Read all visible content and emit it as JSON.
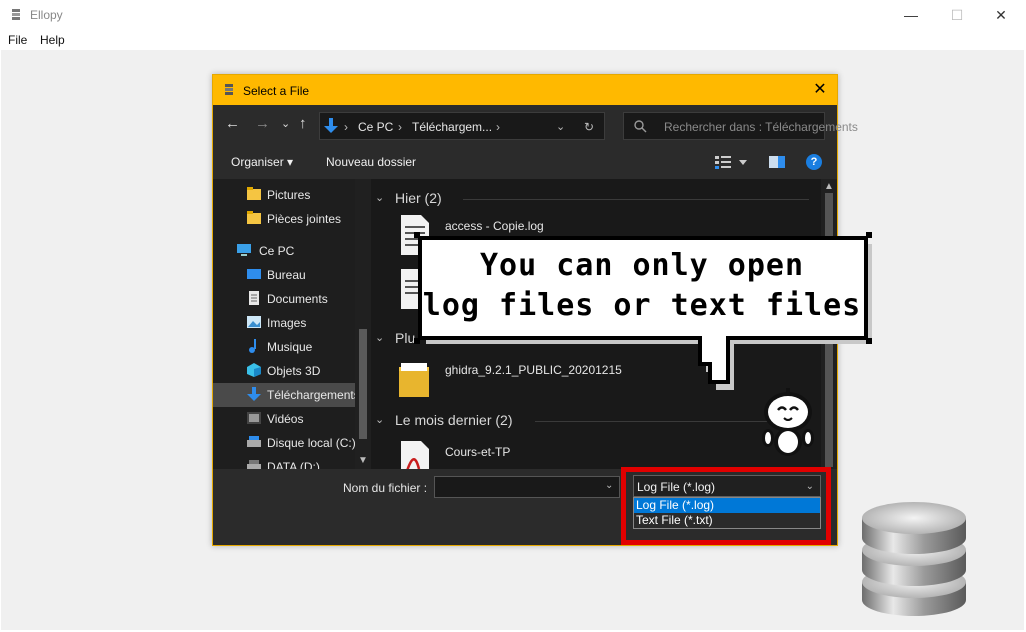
{
  "window": {
    "title": "Ellopy",
    "controls": {
      "minimize": "—",
      "maximize": "☐",
      "close": "✕"
    }
  },
  "menubar": {
    "items": [
      "File",
      "Help"
    ]
  },
  "dialog": {
    "title": "Select a File",
    "close_glyph": "✕",
    "nav": {
      "back": "←",
      "forward": "→",
      "recent": "⌄",
      "up": "↑",
      "refresh": "↻",
      "breadcrumbs": [
        "Ce PC",
        "Téléchargem..."
      ]
    },
    "search_placeholder": "Rechercher dans : Téléchargements",
    "toolbar": {
      "organize": "Organiser",
      "new_folder": "Nouveau dossier",
      "help": "?"
    },
    "sidebar": [
      {
        "label": "Pictures",
        "icon": "folder-icon"
      },
      {
        "label": "Pièces jointes",
        "icon": "folder-icon"
      },
      {
        "label": "Ce PC",
        "icon": "computer-icon"
      },
      {
        "label": "Bureau",
        "icon": "desktop-icon"
      },
      {
        "label": "Documents",
        "icon": "documents-icon"
      },
      {
        "label": "Images",
        "icon": "images-icon"
      },
      {
        "label": "Musique",
        "icon": "music-icon"
      },
      {
        "label": "Objets 3D",
        "icon": "objects3d-icon"
      },
      {
        "label": "Téléchargements",
        "icon": "downloads-icon",
        "selected": true
      },
      {
        "label": "Vidéos",
        "icon": "videos-icon"
      },
      {
        "label": "Disque local (C:)",
        "icon": "drive-icon"
      },
      {
        "label": "DATA (D:)",
        "icon": "drive-icon"
      }
    ],
    "groups": [
      {
        "header": "Hier (2)",
        "files": [
          {
            "name": "access - Copie.log",
            "icon": "document-icon"
          },
          {
            "name": "",
            "icon": "document-icon"
          }
        ]
      },
      {
        "header": "Plu",
        "files": [
          {
            "name": "ghidra_9.2.1_PUBLIC_20201215",
            "icon": "folder-icon"
          }
        ]
      },
      {
        "header": "Le mois dernier (2)",
        "files": [
          {
            "name": "Cours-et-TP",
            "icon": "pdf-icon"
          }
        ]
      }
    ],
    "filename_label": "Nom du fichier :",
    "filename_value": "",
    "filetype": {
      "selected": "Log File (*.log)",
      "options": [
        "Log File (*.log)",
        "Text File (*.txt)"
      ]
    }
  },
  "annotation": {
    "bubble_line1": "You can only open",
    "bubble_line2": "log files or text files"
  },
  "colors": {
    "dialog_titlebar": "#ffb900",
    "highlight_box": "#e10000",
    "selection": "#0078d7"
  }
}
